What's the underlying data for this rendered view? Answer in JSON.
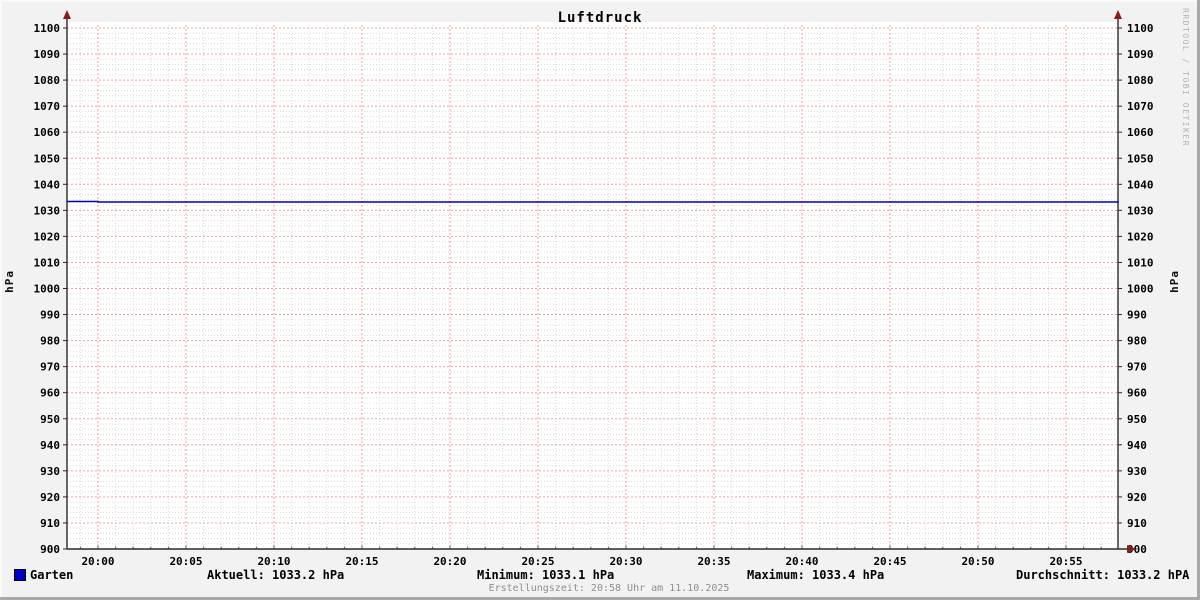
{
  "title": "Luftdruck",
  "watermark": "RRDTOOL / TOBI OETIKER",
  "footer": "Erstellungszeit: 20:58 Uhr am 11.10.2025",
  "colors": {
    "background": "#f2f2f2",
    "plot_bg": "#ffffff",
    "grid_major": "#f0a0a0",
    "grid_minor": "#dadada",
    "axis": "#2b2b2b",
    "arrow": "#8b1a1a",
    "line": "#0000b4",
    "legend_square": "#0000cc"
  },
  "y_axis": {
    "label": "hPa",
    "min": 900,
    "max": 1100,
    "major_step": 10,
    "minor_step": 2
  },
  "x_axis": {
    "ticks": [
      {
        "t": 0,
        "label": "20:00"
      },
      {
        "t": 5,
        "label": "20:05"
      },
      {
        "t": 10,
        "label": "20:10"
      },
      {
        "t": 15,
        "label": "20:15"
      },
      {
        "t": 20,
        "label": "20:20"
      },
      {
        "t": 25,
        "label": "20:25"
      },
      {
        "t": 30,
        "label": "20:30"
      },
      {
        "t": 35,
        "label": "20:35"
      },
      {
        "t": 40,
        "label": "20:40"
      },
      {
        "t": 45,
        "label": "20:45"
      },
      {
        "t": 50,
        "label": "20:50"
      },
      {
        "t": 55,
        "label": "20:55"
      }
    ],
    "minor_step_min": 1
  },
  "legend": {
    "series_label": "Garten",
    "stats": [
      {
        "text": "Aktuell: 1033.2 hPa"
      },
      {
        "text": "Minimum: 1033.1 hPa"
      },
      {
        "text": "Maximum: 1033.4 hPa"
      },
      {
        "text": "Durchschnitt: 1033.2 hPA"
      }
    ]
  },
  "chart_data": {
    "type": "line",
    "title": "Luftdruck",
    "ylabel": "hPa",
    "ylim": [
      900,
      1100
    ],
    "x_range": [
      "19:58",
      "20:58"
    ],
    "grid": true,
    "legend_position": "bottom",
    "series": [
      {
        "name": "Garten",
        "color": "#0000b4",
        "interpolation": "step-after",
        "points": [
          {
            "t": "19:58",
            "v": 1033.4
          },
          {
            "t": "20:00",
            "v": 1033.2
          },
          {
            "t": "20:58",
            "v": 1033.2
          }
        ]
      }
    ],
    "stats": {
      "aktuell": "1033.2 hPa",
      "minimum": "1033.1 hPa",
      "maximum": "1033.4 hPa",
      "durchschnitt": "1033.2 hPA"
    }
  }
}
